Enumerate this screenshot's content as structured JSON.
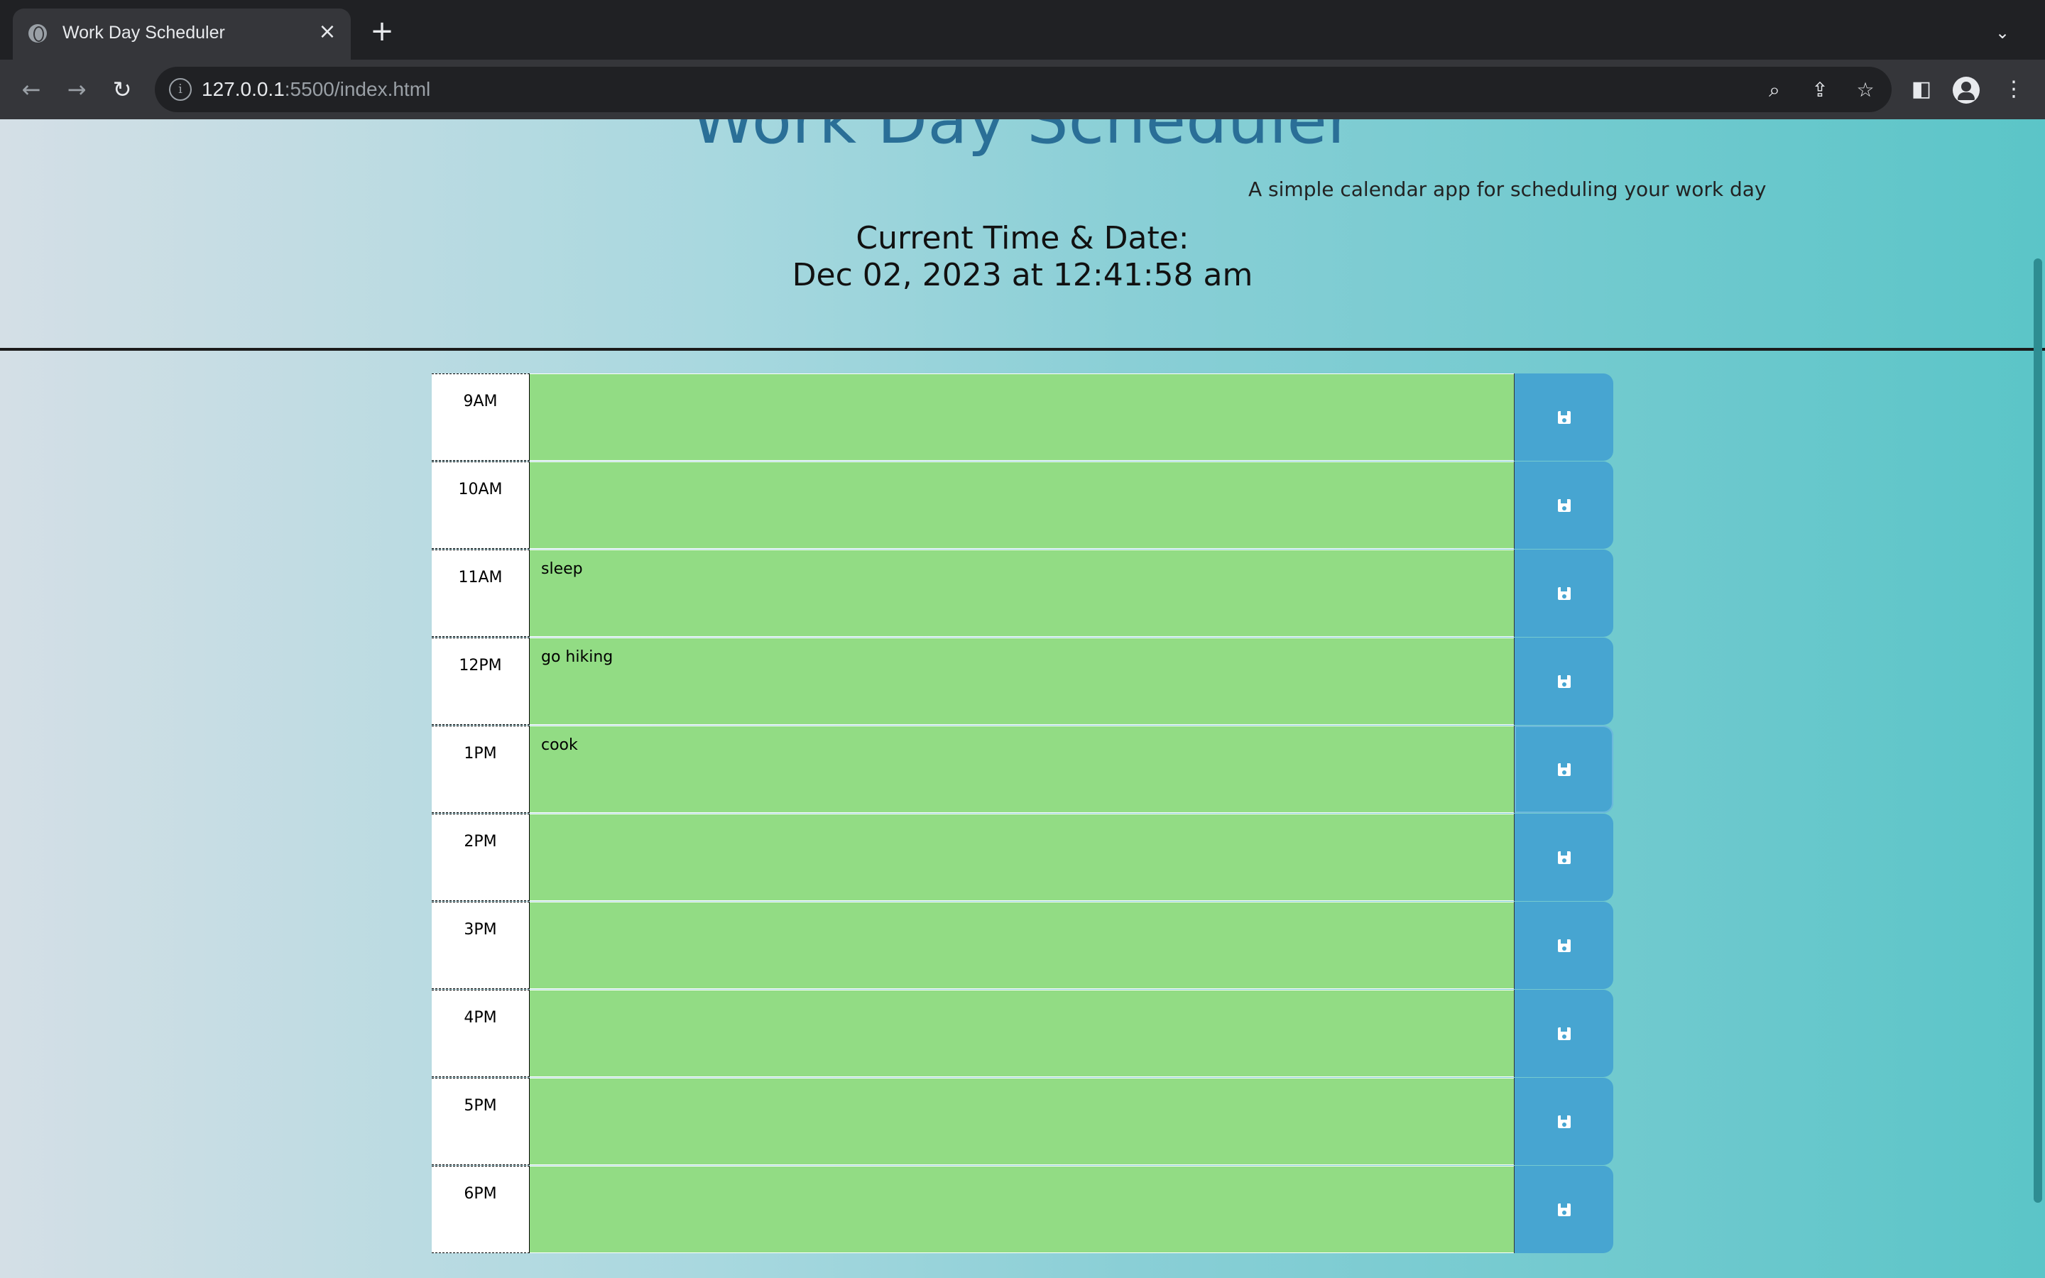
{
  "browser": {
    "tab_title": "Work Day Scheduler",
    "url_host": "127.0.0.1",
    "url_rest": ":5500/index.html"
  },
  "header": {
    "title": "Work Day Scheduler",
    "lead": "A simple calendar app for scheduling your work day",
    "current_label": "Current Time & Date:",
    "current_datetime": "Dec 02, 2023 at 12:41:58 am"
  },
  "colors": {
    "present": "#92dc84",
    "save_button": "#47a5d1",
    "title": "#2a6f97"
  },
  "schedule": [
    {
      "hour": "9AM",
      "text": ""
    },
    {
      "hour": "10AM",
      "text": ""
    },
    {
      "hour": "11AM",
      "text": "sleep"
    },
    {
      "hour": "12PM",
      "text": "go hiking"
    },
    {
      "hour": "1PM",
      "text": "cook"
    },
    {
      "hour": "2PM",
      "text": ""
    },
    {
      "hour": "3PM",
      "text": ""
    },
    {
      "hour": "4PM",
      "text": ""
    },
    {
      "hour": "5PM",
      "text": ""
    },
    {
      "hour": "6PM",
      "text": ""
    }
  ]
}
